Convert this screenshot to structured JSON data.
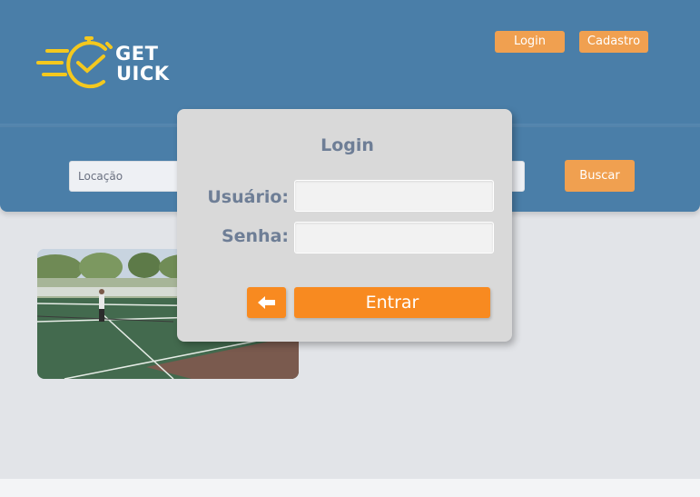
{
  "brand": {
    "line1": "GET",
    "line2": "UICK",
    "logo_icon": "stopwatch-icon",
    "colors": {
      "logo_yellow": "#f4c81e"
    }
  },
  "nav": {
    "login_label": "Login",
    "register_label": "Cadastro"
  },
  "search": {
    "placeholder": "Locação",
    "button_label": "Buscar"
  },
  "listing": {
    "image": "tennis-court-photo"
  },
  "login_modal": {
    "title": "Login",
    "username_label": "Usuário:",
    "password_label": "Senha:",
    "username_value": "",
    "password_value": "",
    "back_icon": "arrow-left-icon",
    "submit_label": "Entrar"
  },
  "colors": {
    "header": "#4a7ea8",
    "accent_orange": "#f88a20",
    "nav_orange": "#f0a050",
    "page_bg": "#e2e4e8",
    "modal_bg": "#d9d9d9",
    "label_text": "#6e7e96"
  }
}
